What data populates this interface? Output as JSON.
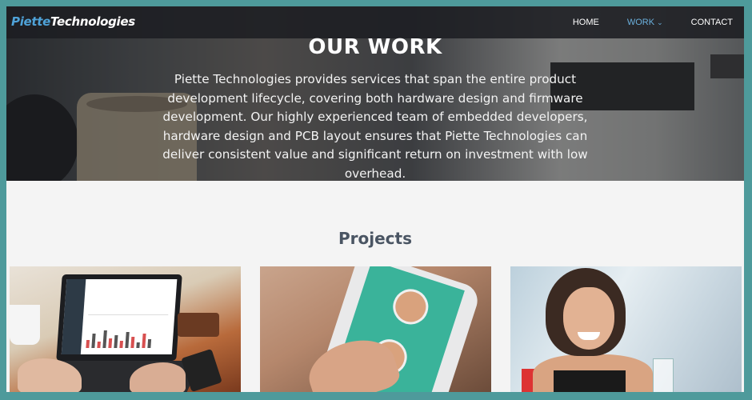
{
  "brand": {
    "part1": "Piette",
    "part2": "Technologies"
  },
  "nav": {
    "items": [
      {
        "label": "HOME"
      },
      {
        "label": "WORK",
        "active": true,
        "has_dropdown": true
      },
      {
        "label": "CONTACT"
      }
    ]
  },
  "hero": {
    "title": "OUR WORK",
    "description": "Piette Technologies provides services that span the entire product development lifecycle, covering both hardware design and firmware development. Our highly experienced team of embedded developers, hardware design and PCB layout ensures that Piette Technologies can deliver consistent value and significant return on investment with low overhead."
  },
  "projects": {
    "heading": "Projects",
    "cards": [
      {
        "image": "laptop-dashboard-photo"
      },
      {
        "image": "smartphone-app-photo"
      },
      {
        "image": "smiling-woman-photo"
      }
    ]
  },
  "colors": {
    "accent": "#4fa3d9",
    "frame": "#4e9a9b",
    "heading": "#4a5563"
  }
}
